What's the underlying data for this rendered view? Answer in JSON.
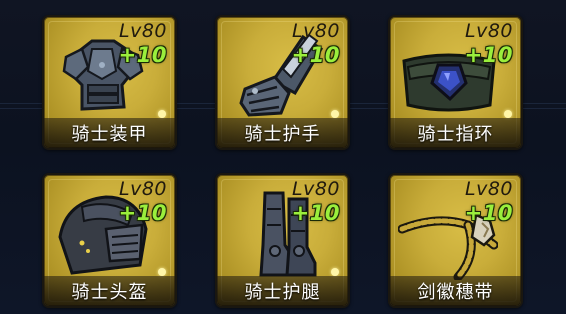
{
  "items": [
    {
      "name": "骑士装甲",
      "level": "Lv80",
      "plus": "+10",
      "icon": "knight-armor-icon"
    },
    {
      "name": "骑士护手",
      "level": "Lv80",
      "plus": "+10",
      "icon": "knight-gauntlet-icon"
    },
    {
      "name": "骑士指环",
      "level": "Lv80",
      "plus": "+10",
      "icon": "knight-ring-icon"
    },
    {
      "name": "骑士头盔",
      "level": "Lv80",
      "plus": "+10",
      "icon": "knight-helmet-icon"
    },
    {
      "name": "骑士护腿",
      "level": "Lv80",
      "plus": "+10",
      "icon": "knight-greaves-icon"
    },
    {
      "name": "剑徽穗带",
      "level": "Lv80",
      "plus": "+10",
      "icon": "sword-tassel-icon"
    }
  ],
  "colors": {
    "card_gold": "#c9ad3a",
    "enhance_green": "#9aef3c",
    "background": "#101523"
  }
}
